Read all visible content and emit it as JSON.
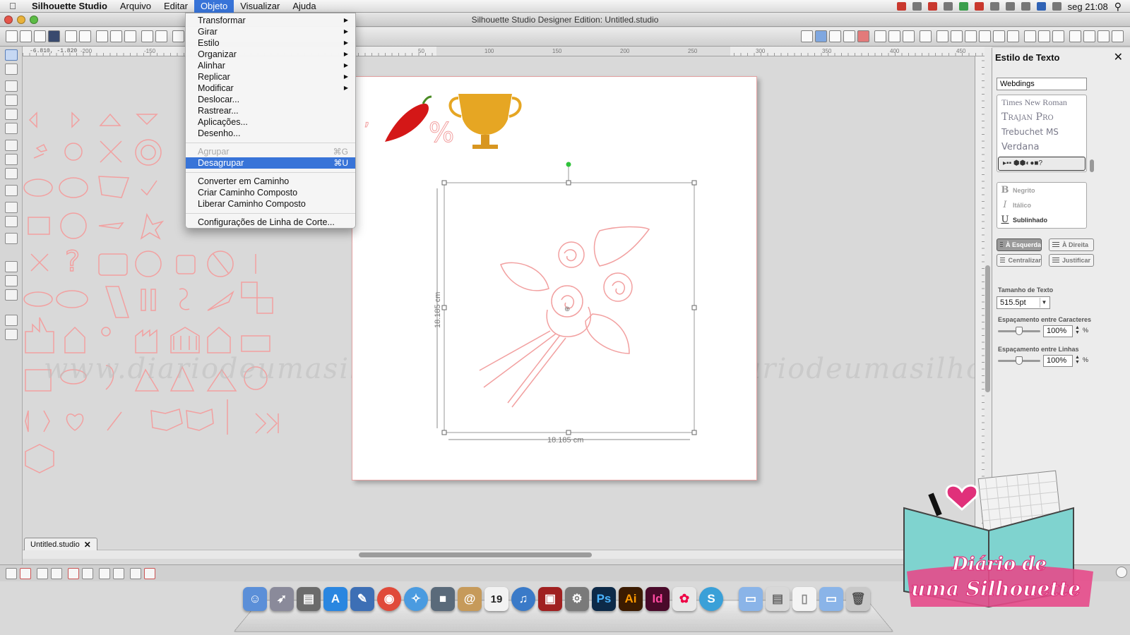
{
  "menubar": {
    "app_name": "Silhouette Studio",
    "items": [
      "Arquivo",
      "Editar",
      "Objeto",
      "Visualizar",
      "Ajuda"
    ],
    "active_item": "Objeto",
    "clock": "seg 21:08"
  },
  "window": {
    "title": "Silhouette Studio Designer Edition: Untitled.studio"
  },
  "ruler": {
    "coordinates": "-6.810, -1.820",
    "h_labels": [
      "-200",
      "-150",
      "50",
      "100",
      "150",
      "200",
      "250",
      "300",
      "350",
      "400",
      "450"
    ]
  },
  "object_menu": {
    "items": [
      {
        "label": "Transformar",
        "submenu": true
      },
      {
        "label": "Girar",
        "submenu": true
      },
      {
        "label": "Estilo",
        "submenu": true
      },
      {
        "label": "Organizar",
        "submenu": true
      },
      {
        "label": "Alinhar",
        "submenu": true
      },
      {
        "label": "Replicar",
        "submenu": true
      },
      {
        "label": "Modificar",
        "submenu": true
      },
      {
        "label": "Deslocar..."
      },
      {
        "label": "Rastrear..."
      },
      {
        "label": "Aplicações..."
      },
      {
        "label": "Desenho..."
      },
      {
        "label": "Agrupar",
        "shortcut": "⌘G",
        "disabled": true
      },
      {
        "label": "Desagrupar",
        "shortcut": "⌘U",
        "highlighted": true
      },
      {
        "label": "Converter em Caminho"
      },
      {
        "label": "Criar Caminho Composto"
      },
      {
        "label": "Liberar Caminho Composto"
      },
      {
        "label": "Configurações de Linha de Corte..."
      }
    ]
  },
  "canvas": {
    "width_label": "18.185 cm",
    "height_label": "18.185 cm",
    "watermark": "www.diariodeumasilhouette.com.br | www.diariodeumasilhouette.com.br"
  },
  "document_tab": {
    "label": "Untitled.studio"
  },
  "text_style_panel": {
    "title": "Estilo de Texto",
    "font_value": "Webdings",
    "fonts": [
      "Times New Roman",
      "Trajan Pro",
      "Trebuchet MS",
      "Verdana"
    ],
    "selected_font_preview": "▸▪▪ ⬢⬢◐●■?",
    "styles": [
      {
        "glyph": "B",
        "label": "Negrito"
      },
      {
        "glyph": "I",
        "label": "Itálico"
      },
      {
        "glyph": "U",
        "label": "Sublinhado"
      }
    ],
    "align": [
      {
        "label": "À Esquerda",
        "active": true
      },
      {
        "label": "À Direita"
      },
      {
        "label": "Centralizar"
      },
      {
        "label": "Justificar"
      }
    ],
    "size_label": "Tamanho de Texto",
    "size_value": "515.5pt",
    "char_spacing_label": "Espaçamento entre Caracteres",
    "char_spacing_value": "100%",
    "line_spacing_label": "Espaçamento entre Linhas",
    "line_spacing_value": "100%",
    "percent_sign": "%"
  },
  "dock": {
    "apps": [
      "Finder",
      "Launchpad",
      "Gerenciador",
      "App Store",
      "Preview",
      "Chrome",
      "Safari",
      "FaceTime",
      "Contatos",
      "Calendário",
      "iTunes",
      "Photo Booth",
      "Preferências",
      "Ps",
      "Ai",
      "Id",
      "Pinwheel",
      "Silhouette",
      "Pasta",
      "Documentos",
      "Arquivo",
      "Downloads",
      "Lixo"
    ],
    "calendar_day": "19",
    "ps": "Ps",
    "ai": "Ai",
    "id": "Id"
  },
  "logo": {
    "line1": "Diário de",
    "line2": "uma Silhouette"
  },
  "colors": {
    "menu_highlight": "#3874d8",
    "shape_stroke": "#f2a0a0",
    "pepper_red": "#d41717",
    "trophy_gold": "#e6a623",
    "logo_teal": "#7fd3cf",
    "logo_pink": "#e0307a"
  }
}
